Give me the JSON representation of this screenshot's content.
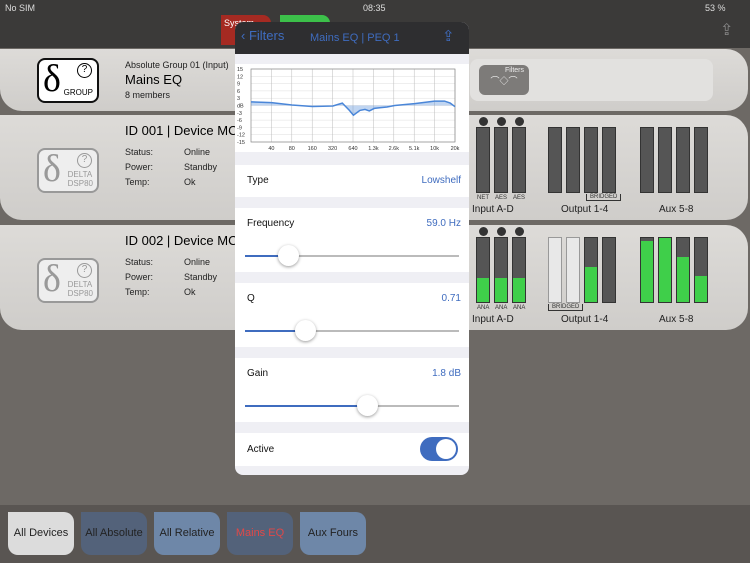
{
  "status_bar": {
    "carrier": "No SIM",
    "time": "08:35",
    "battery": "53 %"
  },
  "topbar": {
    "system_label": "System"
  },
  "group_card": {
    "subtitle": "Absolute Group 01 (Input)",
    "title": "Mains EQ",
    "members": "8 members",
    "logo_text": "GROUP",
    "filters_label": "Filters"
  },
  "devices": [
    {
      "title": "ID 001 | Device MC",
      "status_label": "Status:",
      "status": "Online",
      "power_label": "Power:",
      "power": "Standby",
      "temp_label": "Temp:",
      "temp": "Ok",
      "logo_text": "DELTA DSP80",
      "input_labels": [
        "NET",
        "AES",
        "AES"
      ],
      "output_note": "BRIDGED",
      "groups": [
        "Input A-D",
        "Output 1-4",
        "Aux 5-8"
      ],
      "input_levels": [
        0,
        0,
        0
      ],
      "output_levels": [
        0,
        0,
        0,
        0
      ],
      "aux_levels": [
        0,
        0,
        0,
        0
      ]
    },
    {
      "title": "ID 002 | Device MC",
      "status_label": "Status:",
      "status": "Online",
      "power_label": "Power:",
      "power": "Standby",
      "temp_label": "Temp:",
      "temp": "Ok",
      "logo_text": "DELTA DSP80",
      "input_labels": [
        "ANA",
        "ANA",
        "ANA"
      ],
      "output_note": "BRIDGED",
      "groups": [
        "Input A-D",
        "Output 1-4",
        "Aux 5-8"
      ],
      "input_levels": [
        0.38,
        0.38,
        0.38
      ],
      "output_levels": [
        1,
        1,
        0.55,
        0
      ],
      "aux_levels": [
        0.95,
        1,
        0.7,
        0.4
      ]
    }
  ],
  "popover": {
    "back_label": "Filters",
    "title": "Mains EQ | PEQ 1",
    "type_label": "Type",
    "type_value": "Lowshelf",
    "frequency_label": "Frequency",
    "frequency_value": "59.0 Hz",
    "frequency_pos": 0.2,
    "q_label": "Q",
    "q_value": "0.71",
    "q_pos": 0.28,
    "gain_label": "Gain",
    "gain_value": "1.8 dB",
    "gain_pos": 0.57,
    "active_label": "Active",
    "active": true
  },
  "chart_data": {
    "type": "area",
    "ylabel": "dB",
    "yticks": [
      "15",
      "12",
      "9",
      "6",
      "3",
      "dB",
      "-3",
      "-6",
      "-9",
      "-12",
      "-15"
    ],
    "ylim": [
      -15,
      15
    ],
    "xticks": [
      "40",
      "80",
      "160",
      "320",
      "640",
      "1.3k",
      "2.6k",
      "5.1k",
      "10k",
      "20k"
    ],
    "xlim": [
      20,
      20000
    ],
    "grid": true,
    "points": [
      [
        20,
        1.5
      ],
      [
        40,
        1.2
      ],
      [
        80,
        0.2
      ],
      [
        160,
        -0.4
      ],
      [
        320,
        -0.2
      ],
      [
        440,
        1
      ],
      [
        560,
        -2
      ],
      [
        640,
        -4
      ],
      [
        800,
        -2
      ],
      [
        950,
        -1.6
      ],
      [
        1100,
        -2.2
      ],
      [
        1300,
        -1.2
      ],
      [
        2000,
        -0.6
      ],
      [
        2600,
        0
      ],
      [
        5100,
        0.8
      ],
      [
        10000,
        1.8
      ],
      [
        14000,
        1.8
      ],
      [
        17000,
        1
      ],
      [
        20000,
        -0.5
      ]
    ],
    "color": "#4a86d8"
  },
  "tabs": [
    {
      "label": "All Devices",
      "selected": true
    },
    {
      "label": "All Absolute"
    },
    {
      "label": "All Relative"
    },
    {
      "label": "Mains EQ",
      "color": "#e04848"
    },
    {
      "label": "Aux Fours"
    }
  ]
}
